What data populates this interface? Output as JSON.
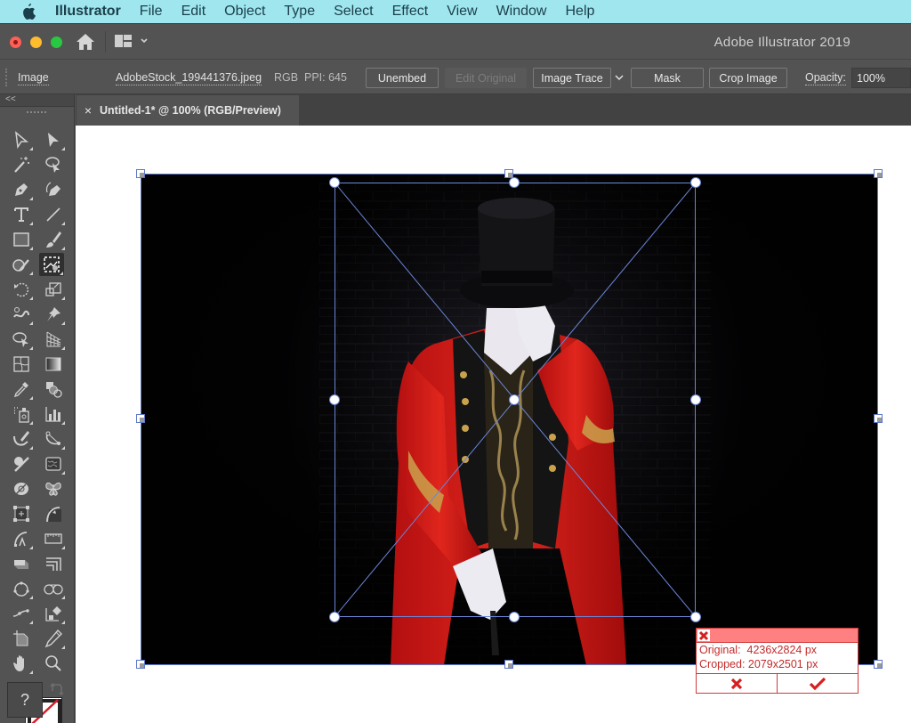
{
  "menubar": {
    "app_name": "Illustrator",
    "items": [
      "File",
      "Edit",
      "Object",
      "Type",
      "Select",
      "Effect",
      "View",
      "Window",
      "Help"
    ]
  },
  "titlebar": {
    "title": "Adobe Illustrator 2019"
  },
  "controlbar": {
    "object_type": "Image",
    "filename": "AdobeStock_199441376.jpeg",
    "color_mode": "RGB",
    "ppi": "PPI: 645",
    "unembed": "Unembed",
    "edit_original": "Edit Original",
    "image_trace": "Image Trace",
    "mask": "Mask",
    "crop_image": "Crop Image",
    "opacity_label": "Opacity:",
    "opacity_value": "100%"
  },
  "tools": {
    "collapse": "<<",
    "help": "?"
  },
  "document": {
    "tab_title": "Untitled-1* @ 100% (RGB/Preview)",
    "close": "×"
  },
  "crop_panel": {
    "original": "Original:  4236x2824 px",
    "cropped": "Cropped: 2079x2501 px"
  },
  "colors": {
    "menubar_bg": "#9fe6ee",
    "ui_bg": "#535353",
    "selection": "#5a78c8",
    "crop_panel_accent": "#d03a3a",
    "crop_panel_header": "#ff8080"
  }
}
